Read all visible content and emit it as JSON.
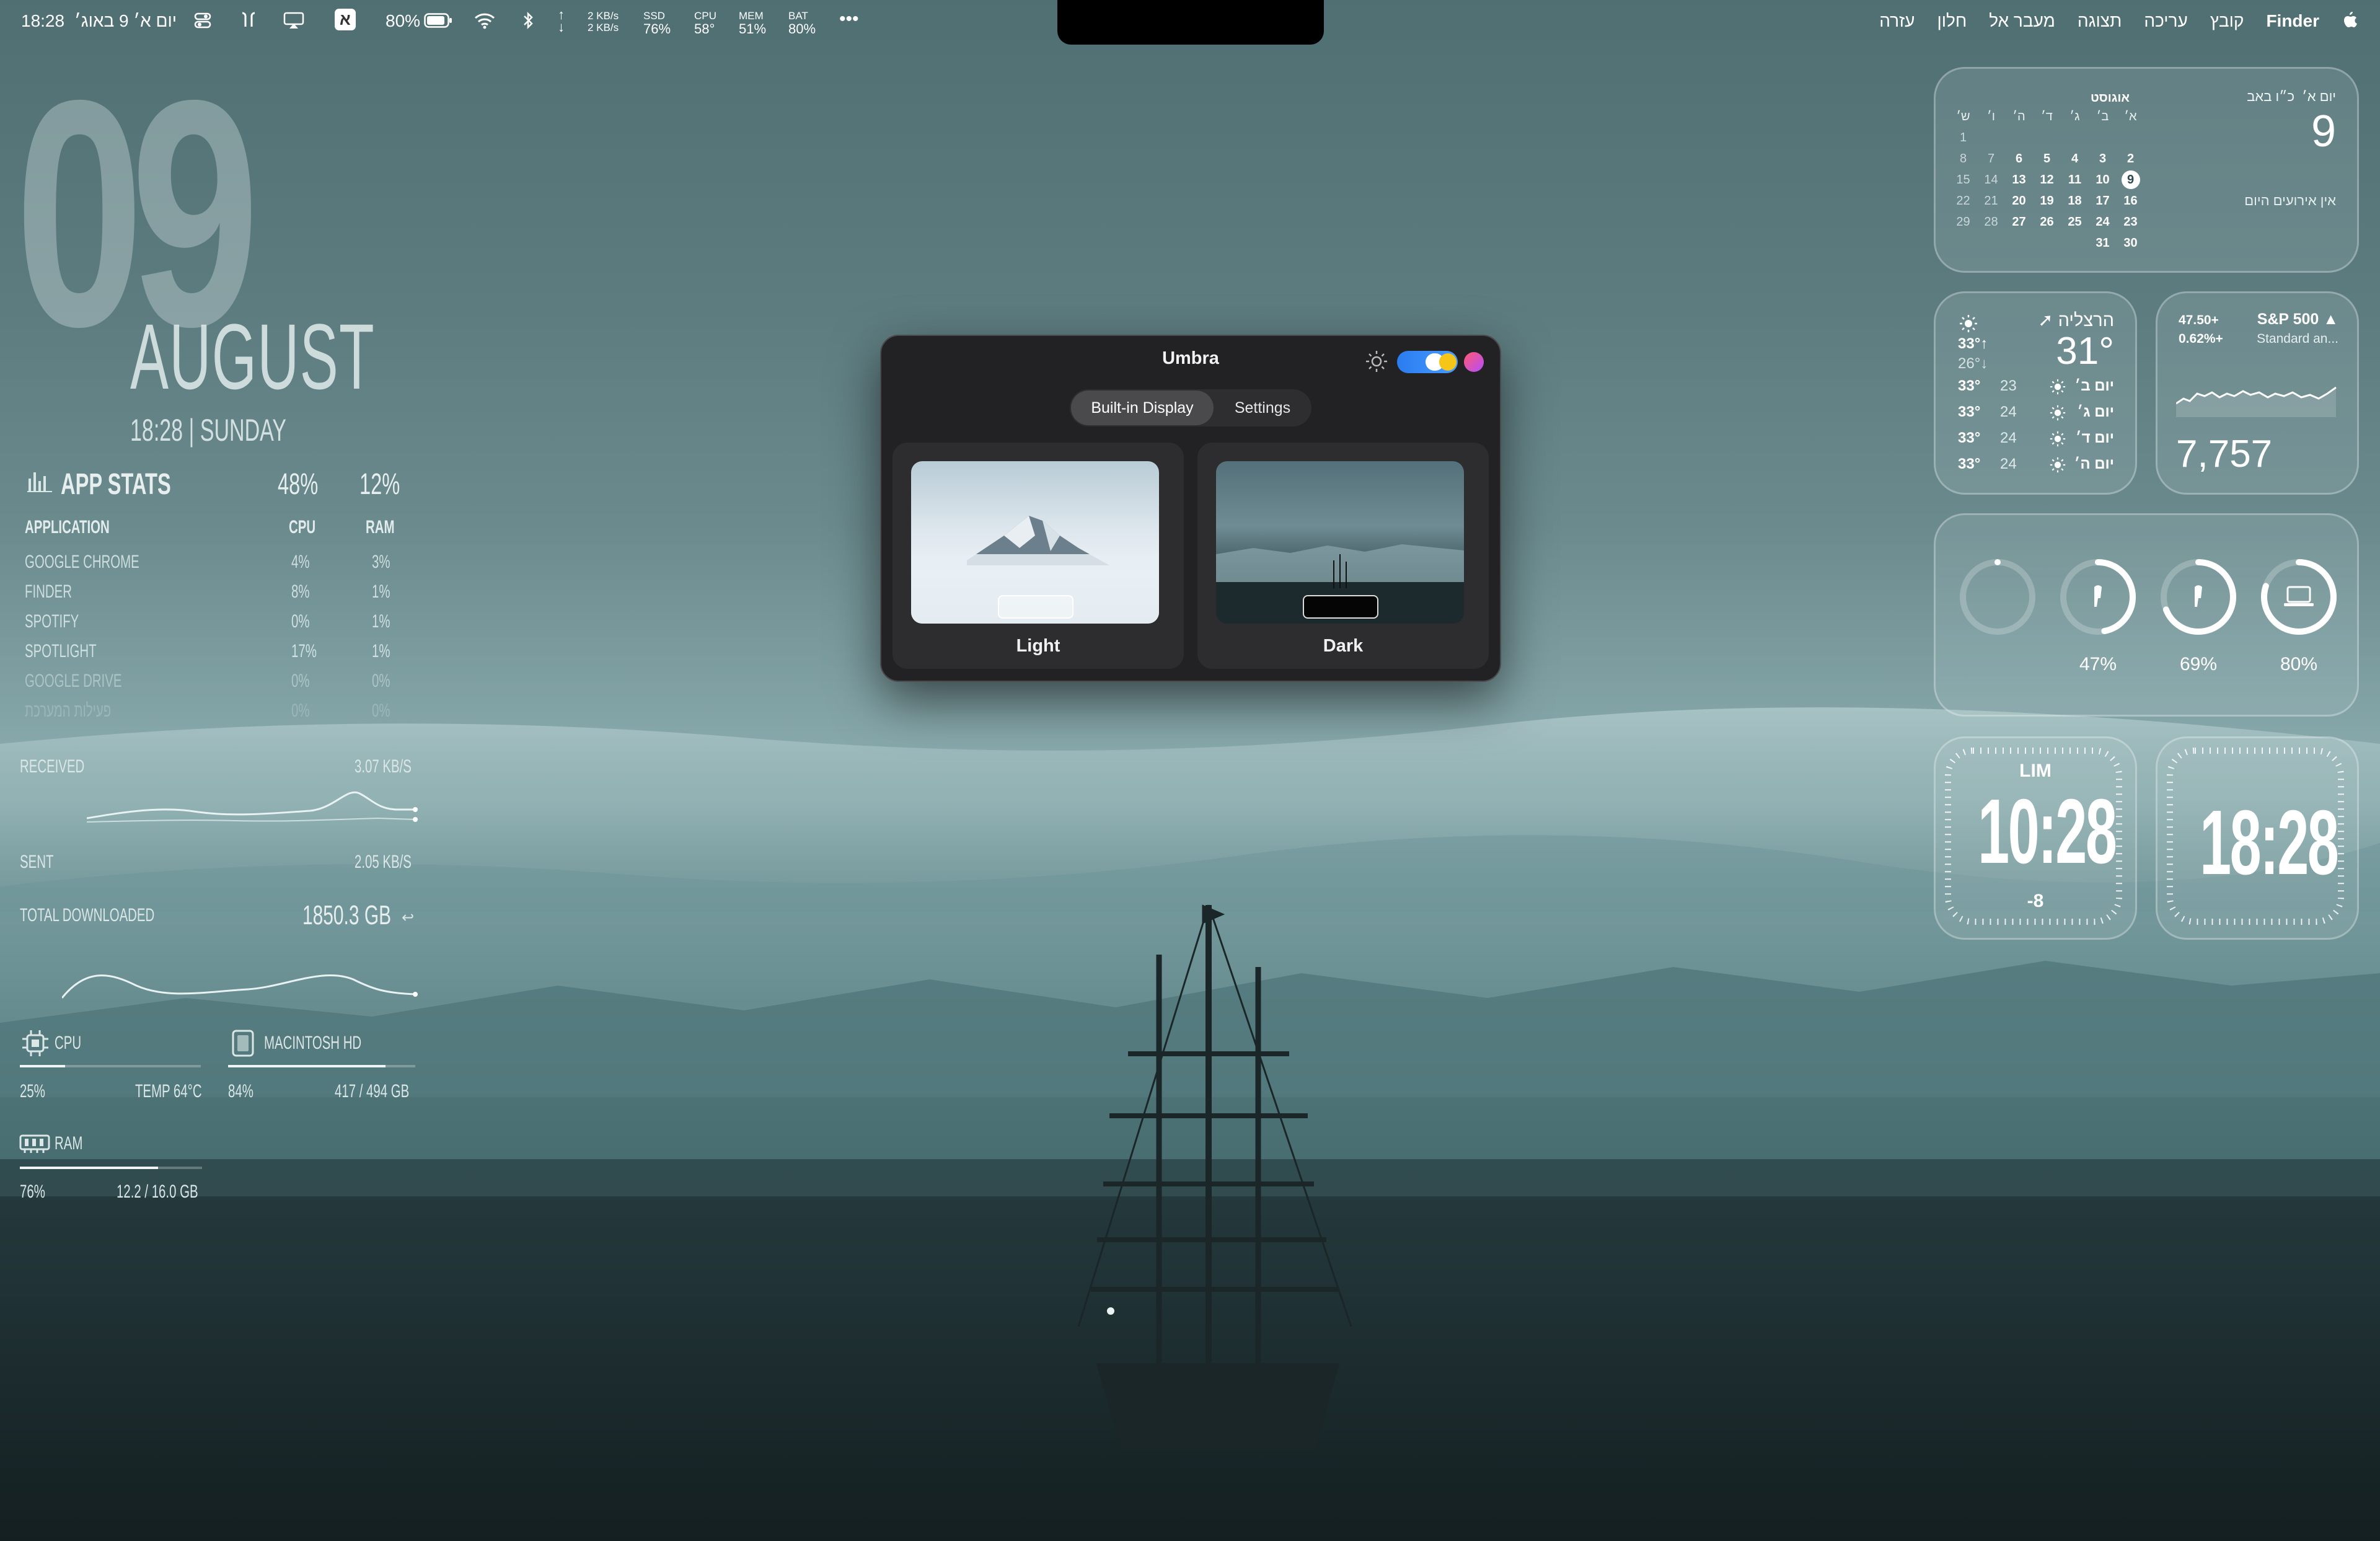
{
  "menubar": {
    "apple": "",
    "app_name": "Finder",
    "menus": [
      "קובץ",
      "עריכה",
      "תצוגה",
      "מעבר אל",
      "חלון",
      "עזרה"
    ],
    "clock": "18:28",
    "date": "יום א׳ 9 באוג׳",
    "input_source": "א",
    "battery": "80%",
    "net_up": "2 KB/s",
    "net_down": "2 KB/s",
    "ssd_label": "SSD",
    "ssd_value": "76%",
    "cpu_label": "CPU",
    "cpu_value": "58°",
    "mem_label": "MEM",
    "mem_value": "51%",
    "bat_label": "BAT",
    "bat_value": "80%",
    "more": "•••"
  },
  "left": {
    "day": "09",
    "month": "AUGUST",
    "time_day": "18:28 | SUNDAY",
    "app_stats": {
      "title": "APP STATS",
      "cpu_total": "48%",
      "ram_total": "12%",
      "col_app": "APPLICATION",
      "col_cpu": "CPU",
      "col_ram": "RAM",
      "rows": [
        {
          "name": "GOOGLE CHROME",
          "cpu": "4%",
          "ram": "3%"
        },
        {
          "name": "FINDER",
          "cpu": "8%",
          "ram": "1%"
        },
        {
          "name": "SPOTIFY",
          "cpu": "0%",
          "ram": "1%"
        },
        {
          "name": "SPOTLIGHT",
          "cpu": "17%",
          "ram": "1%"
        },
        {
          "name": "GOOGLE DRIVE",
          "cpu": "0%",
          "ram": "0%"
        },
        {
          "name": "פעילות המערכת",
          "cpu": "0%",
          "ram": "0%"
        }
      ]
    },
    "network": {
      "received_label": "RECEIVED",
      "received_value": "3.07 KB/S",
      "sent_label": "SENT",
      "sent_value": "2.05 KB/S",
      "total_label": "TOTAL DOWNLOADED",
      "total_value": "1850.3 GB"
    },
    "system": {
      "cpu_label": "CPU",
      "cpu_value": "25%",
      "cpu_temp": "TEMP 64°C",
      "cpu_fill": 0.25,
      "disk_label": "MACINTOSH HD",
      "disk_value": "84%",
      "disk_detail": "417 / 494 GB",
      "disk_fill": 0.84,
      "ram_label": "RAM",
      "ram_value": "76%",
      "ram_detail": "12.2 / 16.0 GB",
      "ram_fill": 0.76
    }
  },
  "umbra": {
    "title": "Umbra",
    "tabs": [
      {
        "label": "Built-in Display",
        "active": true
      },
      {
        "label": "Settings",
        "active": false
      }
    ],
    "options": [
      {
        "label": "Light"
      },
      {
        "label": "Dark"
      }
    ]
  },
  "calendar": {
    "weekday": "יום א׳",
    "hebrew_date": "כ״ו באב",
    "day": "9",
    "no_events": "אין אירועים היום",
    "month": "אוגוסט",
    "headers": [
      "א׳",
      "ב׳",
      "ג׳",
      "ד׳",
      "ה׳",
      "ו׳",
      "ש׳"
    ],
    "weeks": [
      [
        "",
        "",
        "",
        "",
        "",
        "",
        "1"
      ],
      [
        "2",
        "3",
        "4",
        "5",
        "6",
        "7",
        "8"
      ],
      [
        "9",
        "10",
        "11",
        "12",
        "13",
        "14",
        "15"
      ],
      [
        "16",
        "17",
        "18",
        "19",
        "20",
        "21",
        "22"
      ],
      [
        "23",
        "24",
        "25",
        "26",
        "27",
        "28",
        "29"
      ],
      [
        "30",
        "31",
        "",
        "",
        "",
        "",
        ""
      ]
    ],
    "today": "9"
  },
  "weather": {
    "city": "הרצליה",
    "temp": "31°",
    "high": "33°↑",
    "low": "26°↓",
    "forecast": [
      {
        "day": "יום ב׳",
        "hi": "33°",
        "lo": "23"
      },
      {
        "day": "יום ג׳",
        "hi": "33°",
        "lo": "24"
      },
      {
        "day": "יום ד׳",
        "hi": "33°",
        "lo": "24"
      },
      {
        "day": "יום ה׳",
        "hi": "33°",
        "lo": "24"
      }
    ]
  },
  "stocks": {
    "symbol": "S&P 500 ▲",
    "change": "47.50+",
    "change_pct": "0.62%+",
    "name": "Standard an...",
    "value": "7,757"
  },
  "batteries": [
    {
      "label": "",
      "level": 0
    },
    {
      "label": "47%",
      "level": 0.47
    },
    {
      "label": "69%",
      "level": 0.69
    },
    {
      "label": "80%",
      "level": 0.8
    }
  ],
  "clocks": [
    {
      "city": "LIM",
      "time": "10:28",
      "offset": "-8"
    },
    {
      "city": "",
      "time": "18:28",
      "offset": ""
    }
  ]
}
